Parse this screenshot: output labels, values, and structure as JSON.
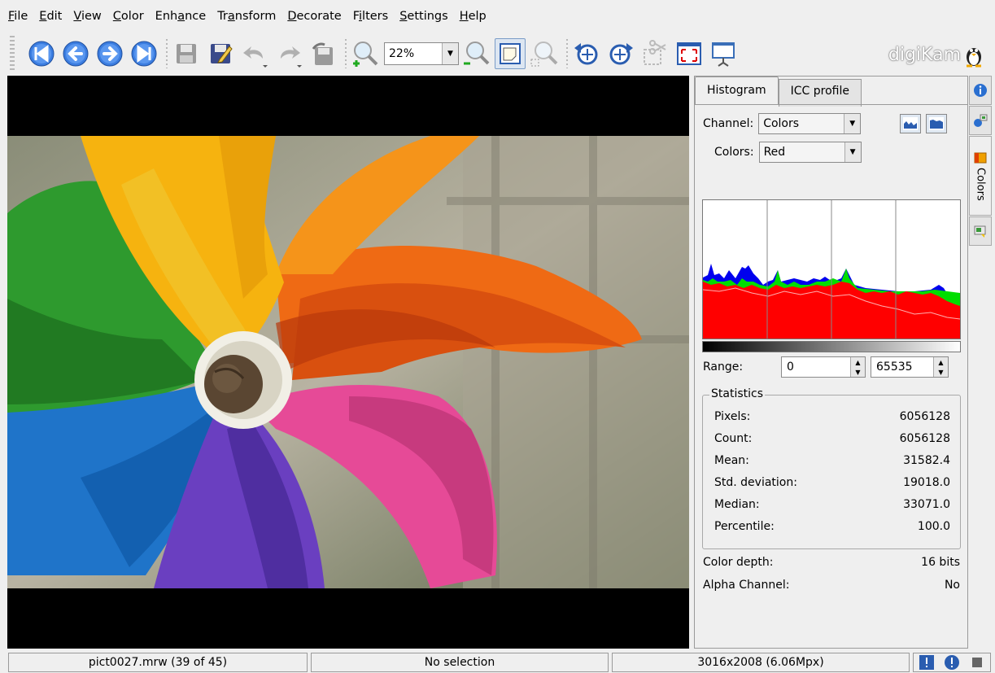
{
  "menu": [
    "File",
    "Edit",
    "View",
    "Color",
    "Enhance",
    "Transform",
    "Decorate",
    "Filters",
    "Settings",
    "Help"
  ],
  "menu_underline_index": [
    0,
    0,
    0,
    0,
    3,
    2,
    0,
    1,
    0,
    0
  ],
  "toolbar": {
    "icons": [
      "first-image",
      "previous-image",
      "next-image",
      "last-image",
      "save",
      "save-as",
      "undo",
      "redo",
      "revert",
      "zoom-in",
      "zoom-out",
      "fit-to-window",
      "zoom-to-selection",
      "rotate-left",
      "rotate-right",
      "crop",
      "fullscreen",
      "slideshow"
    ],
    "zoom_value": "22%"
  },
  "logo_text": "digiKam",
  "panel": {
    "tabs": [
      "Histogram",
      "ICC profile"
    ],
    "channel_label": "Channel:",
    "channel_value": "Colors",
    "colors_label": "Colors:",
    "colors_value": "Red",
    "range_label": "Range:",
    "range_min": "0",
    "range_max": "65535",
    "statistics_title": "Statistics",
    "stats": [
      {
        "label": "Pixels:",
        "value": "6056128"
      },
      {
        "label": "Count:",
        "value": "6056128"
      },
      {
        "label": "Mean:",
        "value": "31582.4"
      },
      {
        "label": "Std. deviation:",
        "value": "19018.0"
      },
      {
        "label": "Median:",
        "value": "33071.0"
      },
      {
        "label": "Percentile:",
        "value": "100.0"
      }
    ],
    "color_depth_label": "Color depth:",
    "color_depth_value": "16 bits",
    "alpha_label": "Alpha Channel:",
    "alpha_value": "No"
  },
  "histogram": {
    "colors": {
      "red": "#ff0000",
      "green": "#00dd00",
      "blue": "#0000ee"
    }
  },
  "sidetab_colors_label": "Colors",
  "status": {
    "file": "pict0027.mrw (39 of 45)",
    "selection": "No selection",
    "size": "3016x2008 (6.06Mpx)"
  }
}
